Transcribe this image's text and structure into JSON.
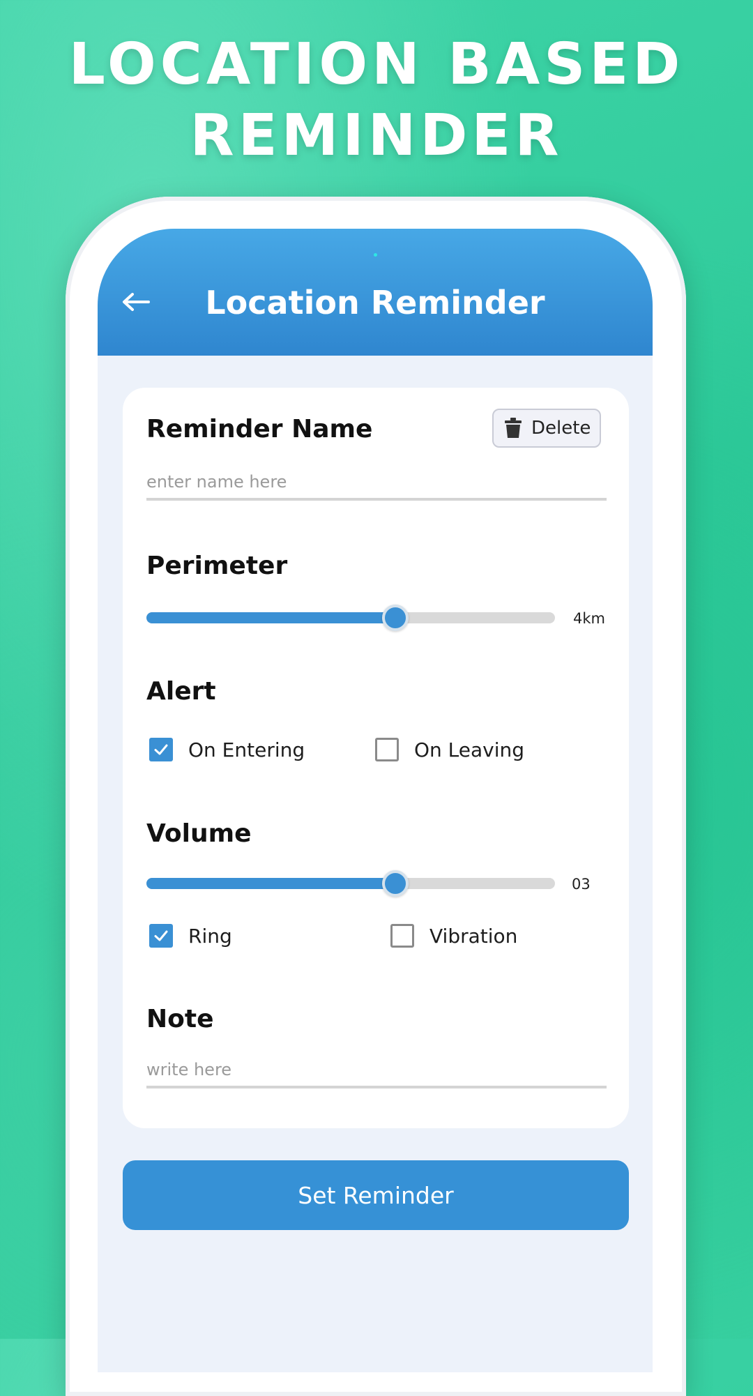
{
  "headline": {
    "line1": "LOCATION BASED",
    "line2": "REMINDER"
  },
  "app": {
    "title": "Location Reminder"
  },
  "form": {
    "reminder_name": {
      "label": "Reminder Name",
      "placeholder": "enter name here",
      "value": ""
    },
    "delete_label": "Delete",
    "perimeter": {
      "label": "Perimeter",
      "value": "4km",
      "level": 0.61
    },
    "alert": {
      "label": "Alert",
      "options": [
        {
          "label": "On Entering",
          "checked": true
        },
        {
          "label": "On Leaving",
          "checked": false
        }
      ]
    },
    "volume": {
      "label": "Volume",
      "value": "03",
      "level": 0.61,
      "options": [
        {
          "label": "Ring",
          "checked": true
        },
        {
          "label": "Vibration",
          "checked": false
        }
      ]
    },
    "note": {
      "label": "Note",
      "placeholder": "write here",
      "value": ""
    },
    "submit_label": "Set Reminder"
  },
  "colors": {
    "accent": "#3a90d4",
    "background": "#35cc9d",
    "header": "#2f86cf"
  },
  "icons": {
    "back": "arrow-left-icon",
    "delete": "trash-icon",
    "check": "checkmark-icon"
  }
}
